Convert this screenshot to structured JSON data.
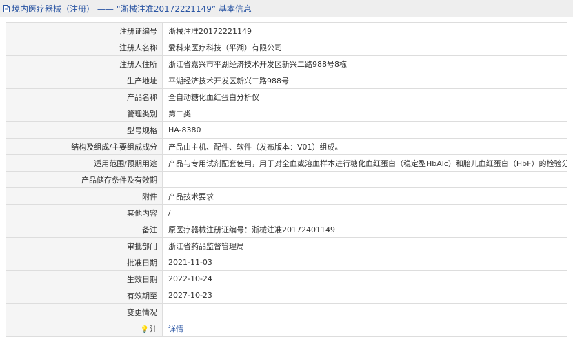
{
  "header": {
    "title": "境内医疗器械（注册） —— “浙械注准20172221149” 基本信息",
    "icon": "document-icon",
    "color": "#2a55a3"
  },
  "rows": [
    {
      "label": "注册证编号",
      "value": "浙械注准20172221149"
    },
    {
      "label": "注册人名称",
      "value": "爱科来医疗科技（平湖）有限公司"
    },
    {
      "label": "注册人住所",
      "value": "浙江省嘉兴市平湖经济技术开发区新兴二路988号8栋"
    },
    {
      "label": "生产地址",
      "value": "平湖经济技术开发区新兴二路988号"
    },
    {
      "label": "产品名称",
      "value": "全自动糖化血红蛋白分析仪"
    },
    {
      "label": "管理类别",
      "value": "第二类"
    },
    {
      "label": "型号规格",
      "value": "HA-8380"
    },
    {
      "label": "结构及组成/主要组成成分",
      "value": "产品由主机、配件、软件（发布版本：V01）组成。"
    },
    {
      "label": "适用范围/预期用途",
      "value": "产品与专用试剂配套使用，用于对全血或溶血样本进行糖化血红蛋白（稳定型HbAlc）和胎儿血红蛋白（HbF）的检验分析。"
    },
    {
      "label": "产品储存条件及有效期",
      "value": ""
    },
    {
      "label": "附件",
      "value": "产品技术要求"
    },
    {
      "label": "其他内容",
      "value": "/"
    },
    {
      "label": "备注",
      "value": "原医疗器械注册证编号：浙械注准20172401149"
    },
    {
      "label": "审批部门",
      "value": "浙江省药品监督管理局"
    },
    {
      "label": "批准日期",
      "value": "2021-11-03"
    },
    {
      "label": "生效日期",
      "value": "2022-10-24"
    },
    {
      "label": "有效期至",
      "value": "2027-10-23"
    },
    {
      "label": "变更情况",
      "value": ""
    }
  ],
  "note_row": {
    "icon": "lightbulb-icon",
    "icon_glyph": "💡",
    "label": "注",
    "link": "详情"
  }
}
